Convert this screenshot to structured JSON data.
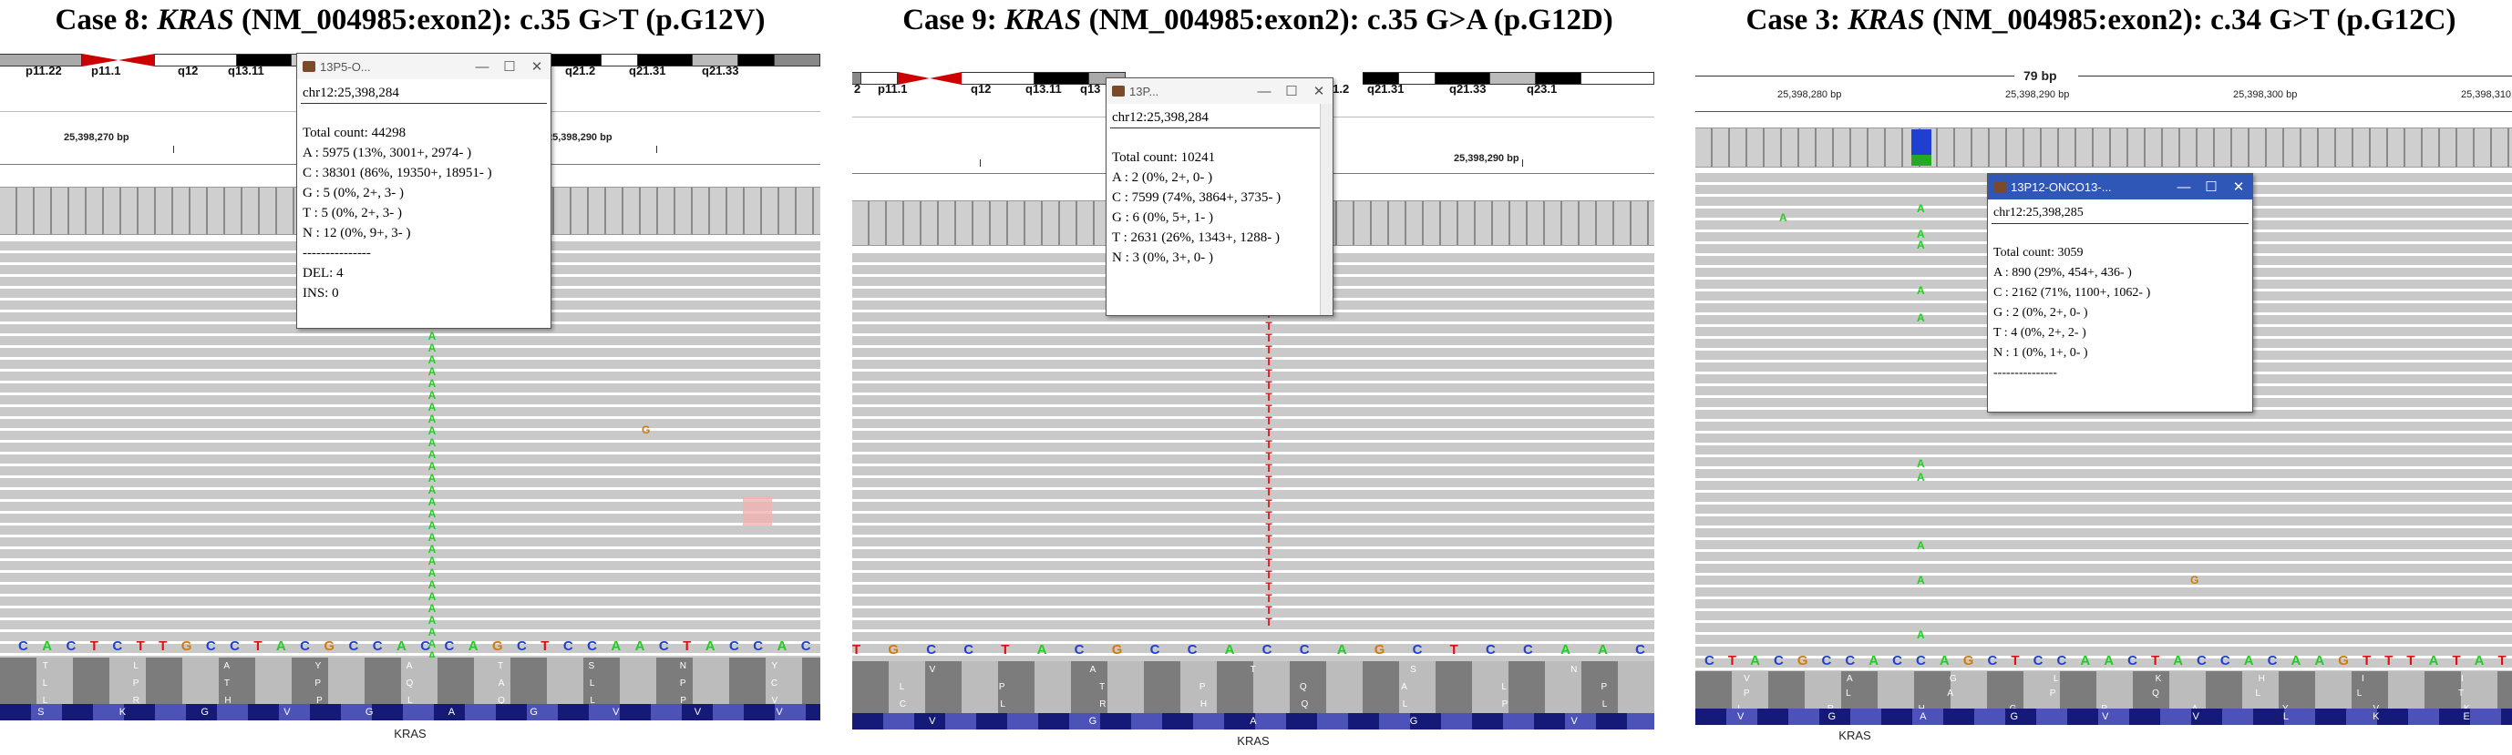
{
  "titles": [
    {
      "case": "Case 8:",
      "gene": "KRAS",
      "rest": "(NM_004985:exon2): c.35 G>T (p.G12V)"
    },
    {
      "case": "Case 9:",
      "gene": "KRAS",
      "rest": "(NM_004985:exon2): c.35 G>A (p.G12D)"
    },
    {
      "case": "Case 3:",
      "gene": "KRAS",
      "rest": "(NM_004985:exon2): c.34 G>T (p.G12C)"
    }
  ],
  "panel1": {
    "bands": [
      "p11.22",
      "p11.1",
      "q12",
      "q13.11",
      "q21.2",
      "q21.31",
      "q21.33"
    ],
    "ruler": [
      "25,398,270 bp",
      "25,398,290 bp"
    ],
    "variant_base": "A",
    "extra_base": "G",
    "sequence": [
      "C",
      "A",
      "C",
      "T",
      "C",
      "T",
      "T",
      "G",
      "C",
      "C",
      "T",
      "A",
      "C",
      "G",
      "C",
      "C",
      "A",
      "C",
      "C",
      "A",
      "G",
      "C",
      "T",
      "C",
      "C",
      "A",
      "A",
      "C",
      "T",
      "A",
      "C",
      "C",
      "A",
      "C"
    ],
    "amino_row1": [
      "T",
      "L",
      "A",
      "Y",
      "A",
      "T",
      "S",
      "N",
      "Y"
    ],
    "amino_row2": [
      "L",
      "P",
      "T",
      "P",
      "Q",
      "A",
      "L",
      "P",
      "C"
    ],
    "amino_row3": [
      "L",
      "R",
      "H",
      "P",
      "L",
      "Q",
      "L",
      "P",
      "V"
    ],
    "kbar": [
      "S",
      "K",
      "G",
      "V",
      "G",
      "A",
      "G",
      "V",
      "V",
      "V"
    ],
    "gene": "KRAS",
    "popup": {
      "title": "13P5-O...",
      "locus": "chr12:25,398,284",
      "lines": [
        "Total count: 44298",
        "A : 5975 (13%, 3001+, 2974- )",
        "C : 38301 (86%, 19350+, 18951- )",
        "G : 5 (0%, 2+, 3- )",
        "T : 5 (0%, 2+, 3- )",
        "N : 12 (0%, 9+, 3- )"
      ],
      "dashes": "---------------",
      "del": "DEL: 4",
      "ins": "INS: 0"
    }
  },
  "panel2": {
    "bands": [
      "2",
      "p11.1",
      "q12",
      "q13.11",
      "q13",
      "q21.2",
      "q21.31",
      "q21.33",
      "q23.1"
    ],
    "ruler": [
      "25,398,290 bp"
    ],
    "variant_base": "T",
    "sequence": [
      "T",
      "G",
      "C",
      "C",
      "T",
      "A",
      "C",
      "G",
      "C",
      "C",
      "A",
      "C",
      "C",
      "A",
      "G",
      "C",
      "T",
      "C",
      "C",
      "A",
      "A",
      "C"
    ],
    "amino_row1": [
      "V",
      "A",
      "T",
      "S",
      "N"
    ],
    "amino_row2": [
      "L",
      "P",
      "T",
      "P",
      "Q",
      "A",
      "L",
      "P"
    ],
    "amino_row3": [
      "C",
      "L",
      "R",
      "H",
      "Q",
      "L",
      "P",
      "L"
    ],
    "kbar": [
      "V",
      "G",
      "A",
      "G",
      "V"
    ],
    "gene": "KRAS",
    "popup": {
      "title": "13P...",
      "locus": "chr12:25,398,284",
      "lines": [
        "Total count: 10241",
        "A : 2 (0%, 2+, 0- )",
        "C : 7599 (74%, 3864+, 3735- )",
        "G : 6 (0%, 5+, 1- )",
        "T : 2631 (26%, 1343+, 1288- )",
        "N : 3 (0%, 3+, 0- )"
      ]
    }
  },
  "panel3": {
    "span": "79 bp",
    "ruler": [
      "25,398,280 bp",
      "25,398,290 bp",
      "25,398,300 bp",
      "25,398,310"
    ],
    "variant_base": "A",
    "extra_base": "G",
    "sequence": [
      "C",
      "T",
      "A",
      "C",
      "G",
      "C",
      "C",
      "A",
      "C",
      "C",
      "A",
      "G",
      "C",
      "T",
      "C",
      "C",
      "A",
      "A",
      "C",
      "T",
      "A",
      "C",
      "C",
      "A",
      "C",
      "A",
      "A",
      "G",
      "T",
      "T",
      "T",
      "A",
      "T",
      "A",
      "T"
    ],
    "amino_row1": [
      "V",
      "A",
      "G",
      "L",
      "K",
      "H",
      "I",
      "I"
    ],
    "amino_row2": [
      "P",
      "L",
      "A",
      "P",
      "Q",
      "L",
      "L",
      "T"
    ],
    "amino_row3": [
      "L",
      "R",
      "H",
      "G",
      "P",
      "A",
      "Y",
      "V",
      "K"
    ],
    "kbar": [
      "V",
      "G",
      "A",
      "G",
      "V",
      "V",
      "L",
      "K",
      "E"
    ],
    "gene": "KRAS",
    "popup": {
      "title": "13P12-ONCO13-...",
      "locus": "chr12:25,398,285",
      "lines": [
        "Total count: 3059",
        "A : 890 (29%, 454+, 436- )",
        "C : 2162 (71%, 1100+, 1062- )",
        "G : 2 (0%, 2+, 0- )",
        "T : 4 (0%, 2+, 2- )",
        "N : 1 (0%, 1+, 0- )"
      ],
      "dashes": "---------------"
    }
  },
  "colors": {
    "A": "#22cc22",
    "C": "#1f3fd0",
    "G": "#d07a10",
    "T": "#dd1111",
    "popup_blue": "#2f57b8"
  },
  "icons": {
    "minimize": "—",
    "maximize": "☐",
    "close": "✕"
  }
}
